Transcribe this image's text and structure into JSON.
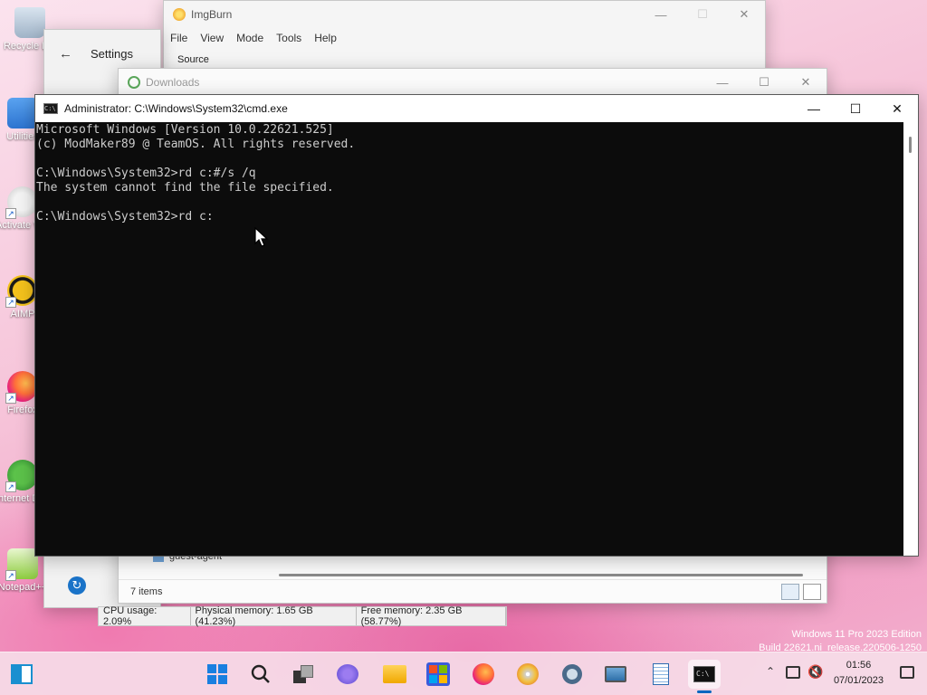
{
  "desktop": {
    "icons": [
      {
        "label": "Recycle Bin"
      },
      {
        "label": "Utilities"
      },
      {
        "label": "Activate Windows"
      },
      {
        "label": "AIMP"
      },
      {
        "label": "Firefox"
      },
      {
        "label": "Internet Download Manager"
      },
      {
        "label": "Notepad++"
      }
    ],
    "watermark": {
      "line1": "Windows 11 Pro 2023 Edition",
      "line2": "Build 22621.ni_release.220506-1250"
    }
  },
  "imgburn": {
    "title": "ImgBurn",
    "menu": [
      "File",
      "View",
      "Mode",
      "Tools",
      "Help"
    ],
    "source_label": "Source"
  },
  "settings": {
    "title": "Settings"
  },
  "downloads": {
    "title": "Downloads",
    "folder_item": "guest-agent",
    "status": "7 items"
  },
  "procbar": {
    "cpu": "CPU usage: 2.09%",
    "physical": "Physical memory: 1.65 GB (41.23%)",
    "free": "Free memory: 2.35 GB (58.77%)"
  },
  "cmd": {
    "title": "Administrator: C:\\Windows\\System32\\cmd.exe",
    "lines": [
      "Microsoft Windows [Version 10.0.22621.525]",
      "(c) ModMaker89 @ TeamOS. All rights reserved.",
      "",
      "C:\\Windows\\System32>rd c:#/s /q",
      "The system cannot find the file specified.",
      "",
      "C:\\Windows\\System32>rd c:"
    ]
  },
  "taskbar": {
    "icons": [
      "start-icon",
      "search-icon",
      "task-view-icon",
      "teams-icon",
      "file-explorer-icon",
      "store-icon",
      "firefox-icon",
      "disc-burner-icon",
      "settings-icon",
      "device-manager-icon",
      "notepad-icon",
      "terminal-icon"
    ],
    "time": "01:56",
    "date": "07/01/2023"
  },
  "colors": {
    "terminal_bg": "#0c0c0c",
    "terminal_fg": "#cccccc",
    "accent": "#0067c0"
  }
}
